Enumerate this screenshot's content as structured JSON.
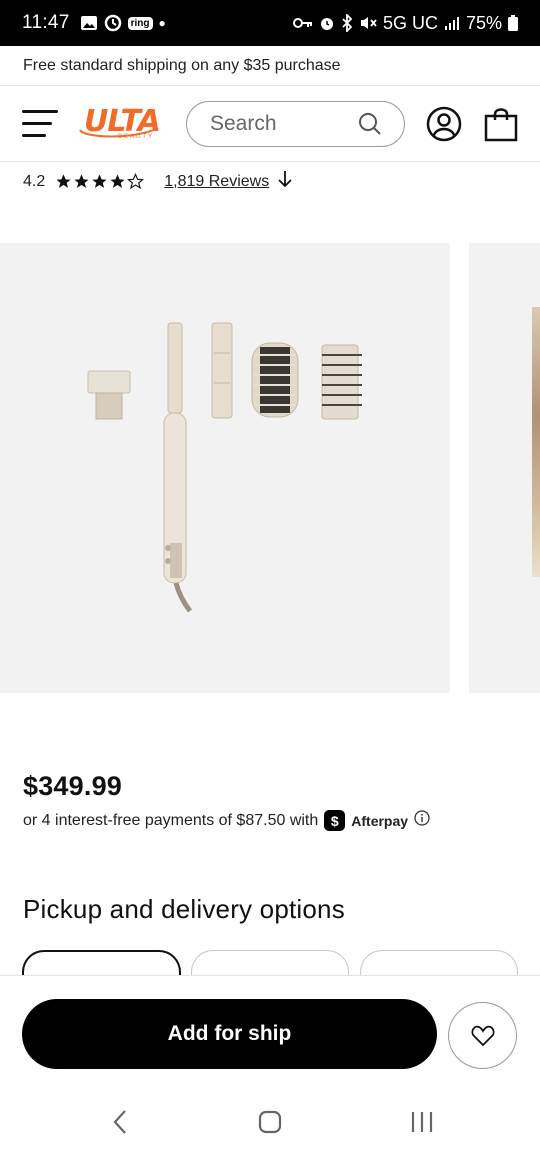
{
  "status_bar": {
    "time": "11:47",
    "ring_label": "ring",
    "network": "5G UC",
    "battery": "75%"
  },
  "promo": {
    "text": "Free standard shipping on any $35 purchase"
  },
  "header": {
    "logo_text": "ULTA",
    "logo_subtext": "BEAUTY",
    "search_placeholder": "Search",
    "brand_color": "#f06c2a"
  },
  "rating": {
    "value": "4.2",
    "stars": 4.2,
    "reviews_text": "1,819 Reviews"
  },
  "pricing": {
    "price": "$349.99",
    "installment_text": "or 4 interest-free payments of $87.50 with",
    "afterpay_icon": "$",
    "afterpay_label": "Afterpay"
  },
  "pickup": {
    "heading": "Pickup and delivery options"
  },
  "cta": {
    "add_label": "Add for ship"
  }
}
